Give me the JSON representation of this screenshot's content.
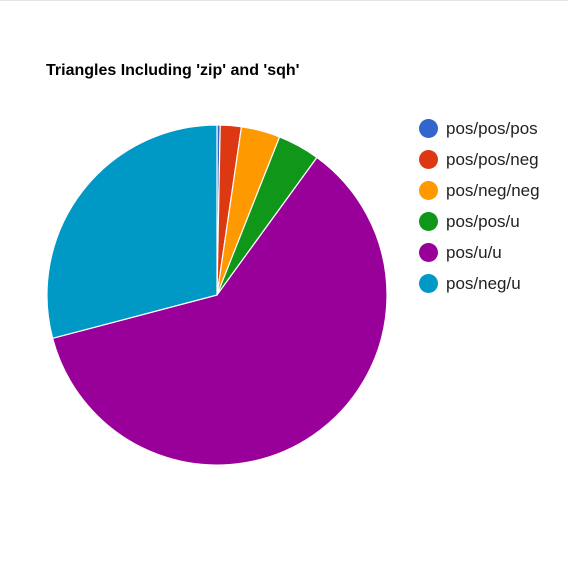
{
  "chart_data": {
    "type": "pie",
    "title": "Triangles Including 'zip' and 'sqh'",
    "legend_position": "right",
    "start_angle_deg": 0,
    "series": [
      {
        "name": "pos/pos/pos",
        "value": 0.3,
        "color": "#3366cc"
      },
      {
        "name": "pos/pos/neg",
        "value": 2.0,
        "color": "#dc3912"
      },
      {
        "name": "pos/neg/neg",
        "value": 3.7,
        "color": "#ff9900"
      },
      {
        "name": "pos/pos/u",
        "value": 4.0,
        "color": "#109618"
      },
      {
        "name": "pos/u/u",
        "value": 60.9,
        "color": "#990099"
      },
      {
        "name": "pos/neg/u",
        "value": 29.1,
        "color": "#0099c6"
      }
    ]
  }
}
